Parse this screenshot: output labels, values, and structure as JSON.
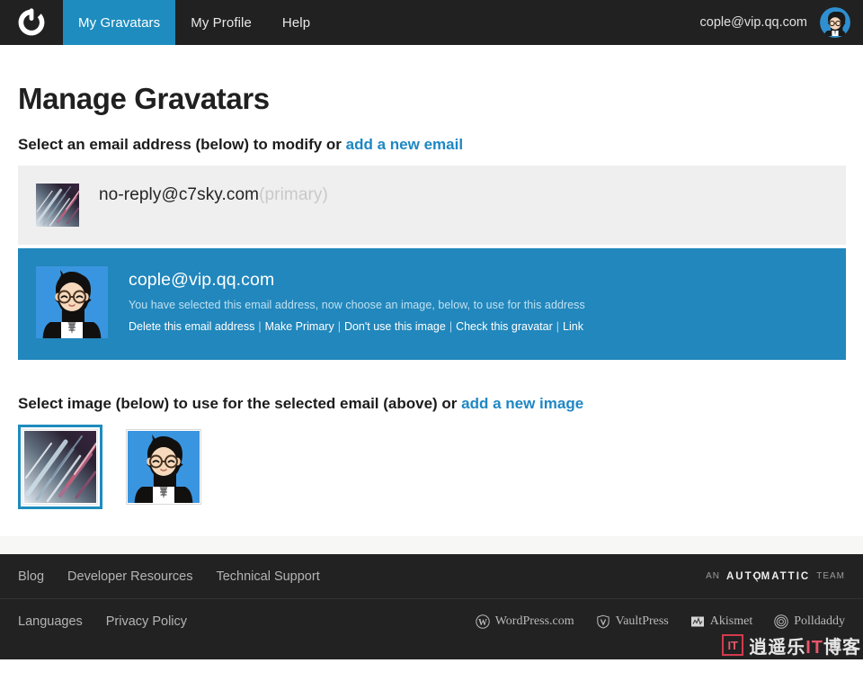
{
  "nav": {
    "logo_icon": "gravatar-logo-icon",
    "items": [
      {
        "label": "My Gravatars",
        "active": true
      },
      {
        "label": "My Profile",
        "active": false
      },
      {
        "label": "Help",
        "active": false
      }
    ],
    "account_email": "cople@vip.qq.com",
    "avatar_icon": "user-avatar"
  },
  "main": {
    "page_title": "Manage Gravatars",
    "email_section": {
      "heading_text": "Select an email address (below) to modify or ",
      "heading_link": "add a new email"
    },
    "emails": [
      {
        "address": "no-reply@c7sky.com",
        "primary_tag": "(primary)",
        "selected": false,
        "thumb": "abstract-streaks-thumbnail"
      },
      {
        "address": "cople@vip.qq.com",
        "selected": true,
        "thumb": "cartoon-avatar-thumbnail",
        "note": "You have selected this email address, now choose an image, below, to use for this address",
        "actions": [
          "Delete this email address",
          "Make Primary",
          "Don't use this image",
          "Check this gravatar",
          "Link"
        ],
        "action_separator": "|"
      }
    ],
    "image_section": {
      "heading_text": "Select image (below) to use for the selected email (above) or ",
      "heading_link": "add a new image",
      "images": [
        {
          "name": "abstract-streaks-image",
          "selected": true
        },
        {
          "name": "cartoon-avatar-image",
          "selected": false
        }
      ]
    }
  },
  "footer": {
    "top_links": [
      "Blog",
      "Developer Resources",
      "Technical Support"
    ],
    "bottom_links": [
      "Languages",
      "Privacy Policy"
    ],
    "automattic": {
      "prefix": "AN",
      "brand_pre": "AUT",
      "brand_post": "MATTIC",
      "suffix": "TEAM"
    },
    "products": [
      {
        "label": "WordPress.com",
        "icon": "wordpress-icon"
      },
      {
        "label": "VaultPress",
        "icon": "vaultpress-shield-icon"
      },
      {
        "label": "Akismet",
        "icon": "akismet-icon"
      },
      {
        "label": "Polldaddy",
        "icon": "polldaddy-icon"
      }
    ],
    "watermark": {
      "badge": "IT",
      "text_a": "逍遥乐",
      "text_b": "IT",
      "text_c": "博客"
    }
  },
  "colors": {
    "nav_bg": "#212121",
    "accent_blue": "#1e8cbe",
    "selected_row_blue": "#2187bc",
    "row_gray": "#efefef",
    "link_blue": "#1e87c4",
    "footer_bg": "#222222"
  }
}
